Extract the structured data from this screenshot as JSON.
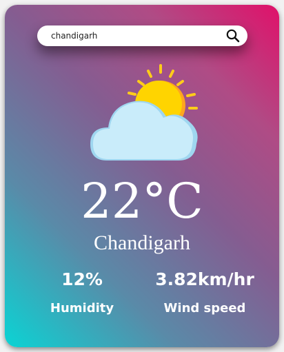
{
  "search": {
    "value": "chandigarh",
    "icon": "search-icon"
  },
  "weather": {
    "icon": "partly-cloudy-icon",
    "temperature": "22°C",
    "city": "Chandigarh"
  },
  "stats": {
    "humidity_value": "12%",
    "humidity_label": "Humidity",
    "wind_value": "3.82km/hr",
    "wind_label": "Wind speed"
  },
  "colors": {
    "gradient_start": "#0ad4d4",
    "gradient_mid": "#845d91",
    "gradient_end": "#e0116a",
    "sun": "#ffd400",
    "cloud": "#c9ecfa"
  }
}
